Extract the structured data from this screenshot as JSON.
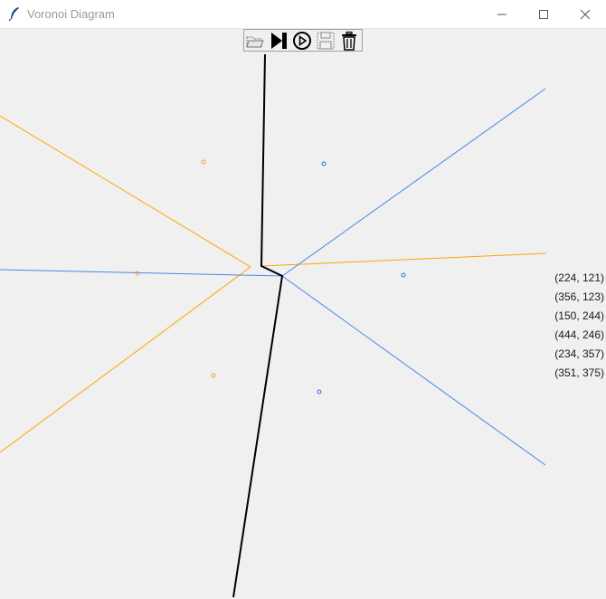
{
  "window": {
    "title": "Voronoi Diagram"
  },
  "toolbar": {
    "buttons": [
      {
        "icon": "open-folder-icon"
      },
      {
        "icon": "step-forward-icon"
      },
      {
        "icon": "play-circle-icon"
      },
      {
        "icon": "save-floppy-icon"
      },
      {
        "icon": "trash-icon"
      }
    ]
  },
  "diagram": {
    "points": [
      {
        "label": "(224, 121)",
        "color": "#e8a23a"
      },
      {
        "label": "(356, 123)",
        "color": "#3a6fd8"
      },
      {
        "label": "(150, 244)",
        "color": "#e8a23a"
      },
      {
        "label": "(444, 246)",
        "color": "#3a6fd8"
      },
      {
        "label": "(234, 357)",
        "color": "#e8a23a"
      },
      {
        "label": "(351, 375)",
        "color": "#3a6fd8"
      }
    ],
    "colors": {
      "voronoi_edge": "#000000",
      "bisector_orange": "#ffa500",
      "bisector_blue": "#4a86e8"
    }
  }
}
